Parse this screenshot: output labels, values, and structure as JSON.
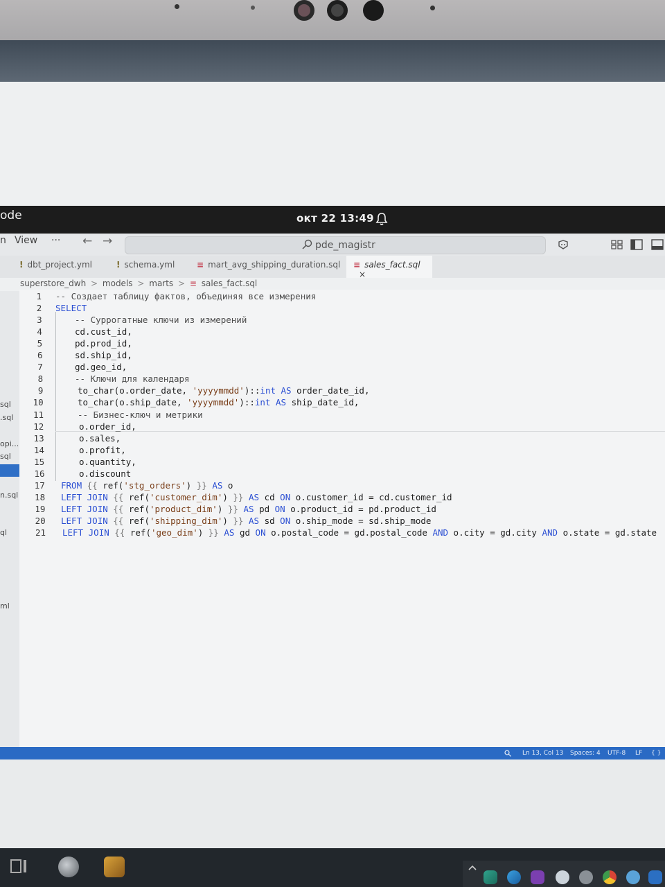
{
  "panel": {
    "app_name": "ode",
    "clock": "окт 22  13:49"
  },
  "titlebar": {
    "menu_partial": "n",
    "menu_view": "View",
    "menu_more": "···",
    "back_arrow": "←",
    "forward_arrow": "→",
    "search_label": "pde_magistr"
  },
  "tabs": [
    {
      "icon": "!",
      "label": "dbt_project.yml"
    },
    {
      "icon": "!",
      "label": "schema.yml"
    },
    {
      "icon": "≡",
      "label": "mart_avg_shipping_duration.sql"
    },
    {
      "icon": "≡",
      "label": "sales_fact.sql",
      "close": "×"
    }
  ],
  "breadcrumb": {
    "items": [
      "superstore_dwh",
      "models",
      "marts",
      "sales_fact.sql"
    ],
    "separator": ">"
  },
  "sidebar_fragments": [
    "sql",
    ".sql",
    "opi...",
    "sql",
    "n.sql",
    "ql",
    "ml"
  ],
  "editor": {
    "lines": [
      {
        "n": "1",
        "text": "-- Создает таблицу фактов, объединяя все измерения"
      },
      {
        "n": "2",
        "text": "SELECT"
      },
      {
        "n": "3",
        "text": "-- Суррогатные ключи из измерений"
      },
      {
        "n": "4",
        "text": "cd.cust_id,"
      },
      {
        "n": "5",
        "text": "pd.prod_id,"
      },
      {
        "n": "6",
        "text": "sd.ship_id,"
      },
      {
        "n": "7",
        "text": "gd.geo_id,"
      },
      {
        "n": "8",
        "text": "-- Ключи для календаря"
      },
      {
        "n": "9",
        "text": "to_char(o.order_date, 'yyyymmdd')::int AS order_date_id,"
      },
      {
        "n": "10",
        "text": "to_char(o.ship_date, 'yyyymmdd')::int AS ship_date_id,"
      },
      {
        "n": "11",
        "text": "-- Бизнес-ключ и метрики"
      },
      {
        "n": "12",
        "text": "o.order_id,"
      },
      {
        "n": "13",
        "text": "o.sales,"
      },
      {
        "n": "14",
        "text": "o.profit,"
      },
      {
        "n": "15",
        "text": "o.quantity,"
      },
      {
        "n": "16",
        "text": "o.discount"
      },
      {
        "n": "17",
        "text": "FROM {{ ref('stg_orders') }} AS o"
      },
      {
        "n": "18",
        "text": "LEFT JOIN {{ ref('customer_dim') }} AS cd ON o.customer_id = cd.customer_id"
      },
      {
        "n": "19",
        "text": "LEFT JOIN {{ ref('product_dim') }} AS pd ON o.product_id = pd.product_id"
      },
      {
        "n": "20",
        "text": "LEFT JOIN {{ ref('shipping_dim') }} AS sd ON o.ship_mode = sd.ship_mode"
      },
      {
        "n": "21",
        "text": "LEFT JOIN {{ ref('geo_dim') }} AS gd ON o.postal_code = gd.postal_code AND o.city = gd.city AND o.state = gd.state"
      }
    ],
    "ibeam": "I"
  },
  "statusbar": {
    "position": "Ln 13, Col 13",
    "spaces": "Spaces: 4",
    "encoding": "UTF-8",
    "eol": "LF",
    "language": "{ }"
  },
  "colors": {
    "accent": "#2a6ac4",
    "keyword": "#2b4fd3",
    "string": "#7a3f1a",
    "panel": "#1c1c1c"
  }
}
